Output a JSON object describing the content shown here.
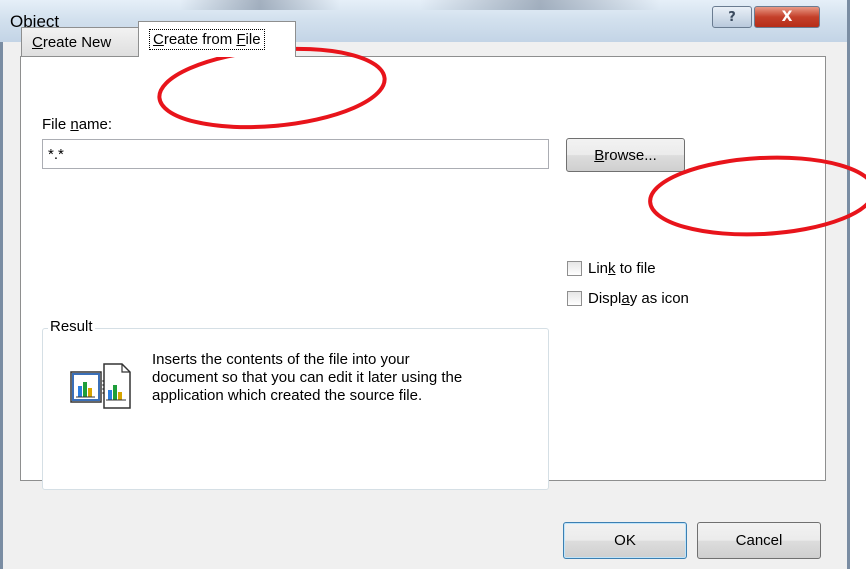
{
  "window": {
    "title": "Object"
  },
  "titlebar": {
    "help_glyph": "?",
    "close_glyph": "X"
  },
  "tabs": [
    {
      "pre": "",
      "mnemonic": "C",
      "post": "reate New",
      "selected": false
    },
    {
      "pre": "",
      "mnemonic": "C",
      "post": "reate from ",
      "mnemonic2": "F",
      "post2": "ile",
      "selected": true
    }
  ],
  "file_name": {
    "label_pre": "File ",
    "label_mnemonic": "n",
    "label_post": "ame:",
    "value": "*.*"
  },
  "browse_button": {
    "mnemonic": "B",
    "post": "rowse..."
  },
  "options": {
    "link_to_file": {
      "pre": "Lin",
      "mnemonic": "k",
      "post": " to file",
      "checked": false
    },
    "display_as_icon": {
      "pre": "Displ",
      "mnemonic": "a",
      "post": "y as icon",
      "checked": false
    }
  },
  "result": {
    "legend": "Result",
    "lines": [
      "Inserts the contents of the file into your",
      "document so that you can edit it later using the",
      "application which created the source file."
    ],
    "icon": "embedded-document-icon"
  },
  "footer": {
    "ok_label": "OK",
    "cancel_label": "Cancel"
  },
  "annotations": {
    "color": "#e8141b",
    "count": 2
  },
  "colors": {
    "accent": "#3c7fb1",
    "annotation": "#e8141b"
  }
}
